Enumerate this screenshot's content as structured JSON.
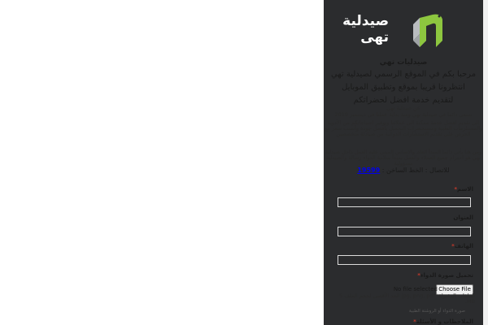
{
  "brand": {
    "logo_text_line1": "صيدلية",
    "logo_text_line2": "تهى",
    "colors": {
      "logo_green": "#8dc63f",
      "logo_gray": "#b9bcbf",
      "panel_bg": "#2b2c2e"
    }
  },
  "intro": {
    "title": "صيدليات تهي",
    "welcome_line1": "مرحبا بكم في الموقع الرسمي لصيدلية تهي",
    "welcome_line2": "انتظرونا قريبا بموقع وتطبيق الموبايل",
    "welcome_line3": "لتقديم خدمة افضل لحضراتكم",
    "about_title": "عن صيدلية تهي",
    "about_date": "نسعى دائما في صيدلية تهي ومنذ بداية عملنا في ديسمبر 2019",
    "about_body": "الى تقديم افضل خدمة ممكنة الى عملائنا وتوفير احتياجاتكم من الأدوية والمستلزمات الطبية ومستحضرات التجميل بأفضل جودة وأنسب سعر مع الحرص على تقديم الاستشارات الدوائية من صيادلة متخصصين",
    "about_tail": "ومن هنا يأتي دائما المبدأ العام والاساس المبني عليه العمل داخل صيدلية تهي هو احترام جميع العملاء والعمل بمبدأ سلامة الدواء رسالة والصيدلية مسؤولية",
    "call_label": "للاتصال : الخط الساخن :",
    "call_number": "19599"
  },
  "form": {
    "name_label": "الاسم",
    "address_label": "العنوان",
    "phone_label": "الهاتف",
    "prescription_label": "تحميل صورة الدواء",
    "required_mark": "*",
    "choose_file_button": "Choose File",
    "no_file_text": "No file selected",
    "allowed_files_hint": "الملفات المقبولة: jpg, png, pdf الحد الأقصى لحجم الملف 5 MB.",
    "upload_subhint": "صورة الدواء أو الروشتة الطبية",
    "notes_label": "الملاحظات و الأسئلة"
  }
}
